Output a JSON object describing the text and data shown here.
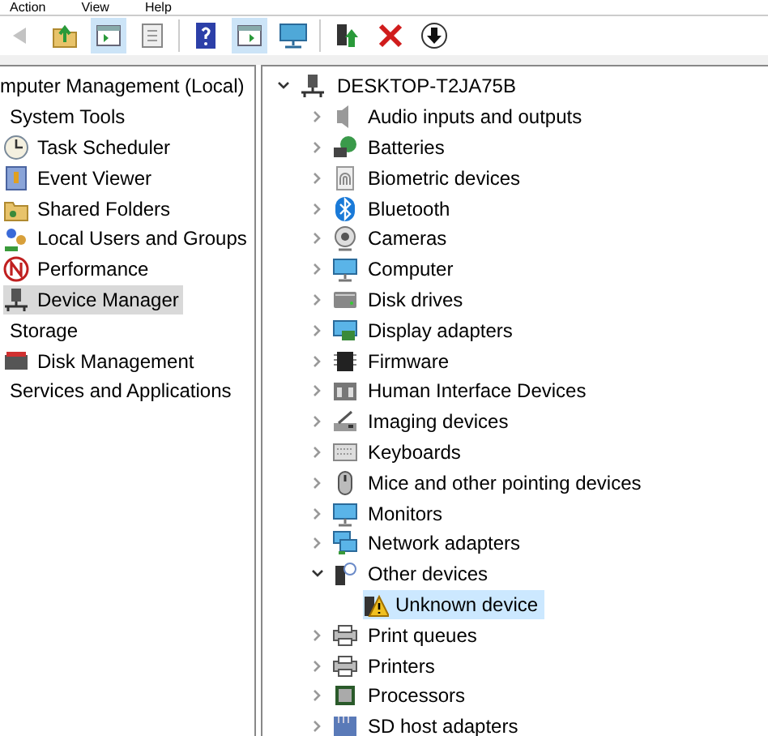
{
  "menu": [
    "Action",
    "View",
    "Help"
  ],
  "toolbar": [
    {
      "kind": "back",
      "pressed": false,
      "disabled": true
    },
    {
      "kind": "up",
      "pressed": false,
      "disabled": false
    },
    {
      "kind": "tree",
      "pressed": true,
      "disabled": false
    },
    {
      "kind": "props",
      "pressed": false,
      "disabled": false
    },
    {
      "kind": "sep"
    },
    {
      "kind": "help",
      "pressed": false,
      "disabled": false
    },
    {
      "kind": "action",
      "pressed": true,
      "disabled": false
    },
    {
      "kind": "monitor",
      "pressed": false,
      "disabled": false
    },
    {
      "kind": "sep"
    },
    {
      "kind": "enable",
      "pressed": false,
      "disabled": false
    },
    {
      "kind": "remove",
      "pressed": false,
      "disabled": false
    },
    {
      "kind": "download",
      "pressed": false,
      "disabled": false
    }
  ],
  "console_tree": {
    "label": "mputer Management (Local)",
    "children": [
      {
        "label": "System Tools",
        "children": [
          {
            "label": "Task Scheduler",
            "selected": false
          },
          {
            "label": "Event Viewer",
            "selected": false
          },
          {
            "label": "Shared Folders",
            "selected": false
          },
          {
            "label": "Local Users and Groups",
            "selected": false
          },
          {
            "label": "Performance",
            "selected": false
          },
          {
            "label": "Device Manager",
            "selected": true
          }
        ]
      },
      {
        "label": "Storage",
        "children": [
          {
            "label": "Disk Management",
            "selected": false
          }
        ]
      },
      {
        "label": "Services and Applications"
      }
    ]
  },
  "device_tree": {
    "label": "DESKTOP-T2JA75B",
    "expanded": true,
    "children": [
      {
        "label": "Audio inputs and outputs",
        "expanded": false
      },
      {
        "label": "Batteries",
        "expanded": false
      },
      {
        "label": "Biometric devices",
        "expanded": false
      },
      {
        "label": "Bluetooth",
        "expanded": false
      },
      {
        "label": "Cameras",
        "expanded": false
      },
      {
        "label": "Computer",
        "expanded": false
      },
      {
        "label": "Disk drives",
        "expanded": false
      },
      {
        "label": "Display adapters",
        "expanded": false
      },
      {
        "label": "Firmware",
        "expanded": false
      },
      {
        "label": "Human Interface Devices",
        "expanded": false
      },
      {
        "label": "Imaging devices",
        "expanded": false
      },
      {
        "label": "Keyboards",
        "expanded": false
      },
      {
        "label": "Mice and other pointing devices",
        "expanded": false
      },
      {
        "label": "Monitors",
        "expanded": false
      },
      {
        "label": "Network adapters",
        "expanded": false
      },
      {
        "label": "Other devices",
        "expanded": true,
        "children": [
          {
            "label": "Unknown device",
            "selected": true
          }
        ]
      },
      {
        "label": "Print queues",
        "expanded": false
      },
      {
        "label": "Printers",
        "expanded": false
      },
      {
        "label": "Processors",
        "expanded": false
      },
      {
        "label": "SD host adapters",
        "expanded": false
      }
    ]
  }
}
